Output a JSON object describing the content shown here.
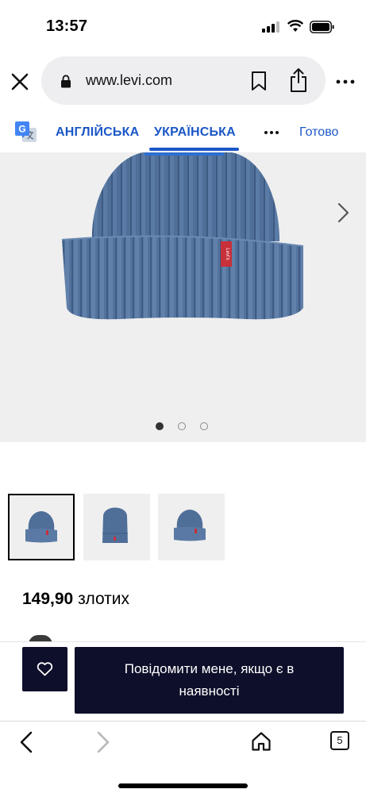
{
  "status": {
    "time": "13:57"
  },
  "browser": {
    "url": "www.levi.com"
  },
  "translate": {
    "source_lang": "АНГЛІЙСЬКА",
    "target_lang": "УКРАЇНСЬКА",
    "done_label": "Готово"
  },
  "gallery": {
    "slide_count": 3,
    "active_slide": 1,
    "thumbnail_count": 3,
    "selected_thumbnail": 1
  },
  "product": {
    "price_amount": "149,90",
    "price_currency": "злотих",
    "notify_label": "Повідомити мене, якщо є в наявності",
    "tag_text": "Levi's",
    "color": "#4f6f99"
  },
  "toolbar": {
    "tab_count": "5"
  },
  "colors": {
    "accent": "#1a57c6",
    "button_dark": "#0e0f2a"
  }
}
